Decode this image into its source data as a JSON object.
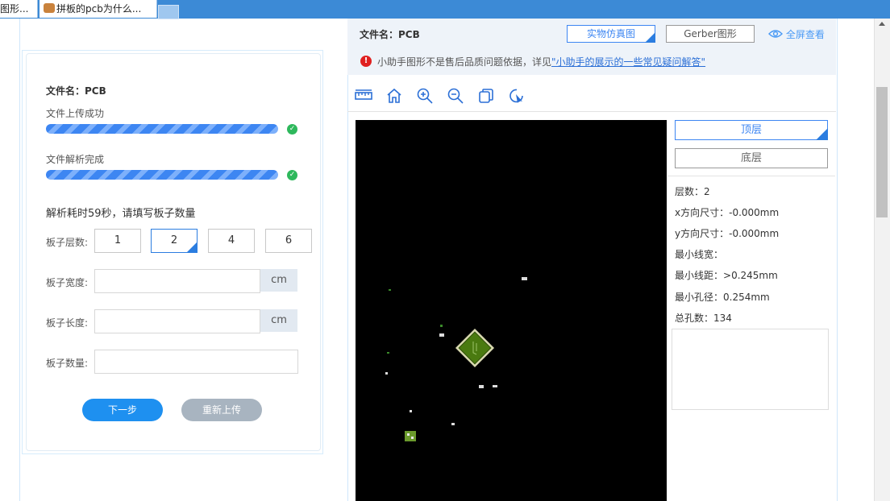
{
  "browser": {
    "tabs": [
      {
        "label": "图形..."
      },
      {
        "label": "拼板的pcb为什么..."
      }
    ]
  },
  "left": {
    "file_label": "文件名：PCB",
    "upload_status": "文件上传成功",
    "upload_progress": 1.0,
    "parse_status": "文件解析完成",
    "parse_progress": 1.0,
    "parse_message": "解析耗时59秒，请填写板子数量",
    "layers_label": "板子层数:",
    "layer_options": [
      "1",
      "2",
      "4",
      "6"
    ],
    "selected_layer": "2",
    "width_label": "板子宽度:",
    "width_unit": "cm",
    "width_value": "",
    "length_label": "板子长度:",
    "length_unit": "cm",
    "length_value": "",
    "qty_label": "板子数量:",
    "qty_value": "",
    "next_button": "下一步",
    "reupload_button": "重新上传"
  },
  "right": {
    "file_label": "文件名：PCB",
    "btn_real": "实物仿真图",
    "btn_gerber": "Gerber图形",
    "btn_fullscreen": "全屏查看",
    "notice_text": "小助手图形不是售后品质问题依据，详见",
    "notice_link": "\"小助手的展示的一些常见疑问解答\"",
    "tools": [
      "ruler-icon",
      "home-icon",
      "zoom-in-icon",
      "zoom-out-icon",
      "copy-icon",
      "rotate-cursor-icon"
    ],
    "layer_top": "顶层",
    "layer_bottom": "底层",
    "info": {
      "layers": "层数：2",
      "x_size_label": "x方向尺寸：",
      "x_size_value": "-0.000mm",
      "y_size_label": "y方向尺寸：",
      "y_size_value": "-0.000mm",
      "min_width_label": "最小线宽：",
      "min_spacing_label": "最小线距：",
      "min_spacing_value": ">0.245mm",
      "min_hole_label": "最小孔径：",
      "min_hole_value": "0.254mm",
      "total_holes": "总孔数：134"
    }
  },
  "colors": {
    "accent": "#3d86f2",
    "success": "#2eb85c",
    "warning": "#e02020",
    "pcb_green": "#4a7a10"
  }
}
